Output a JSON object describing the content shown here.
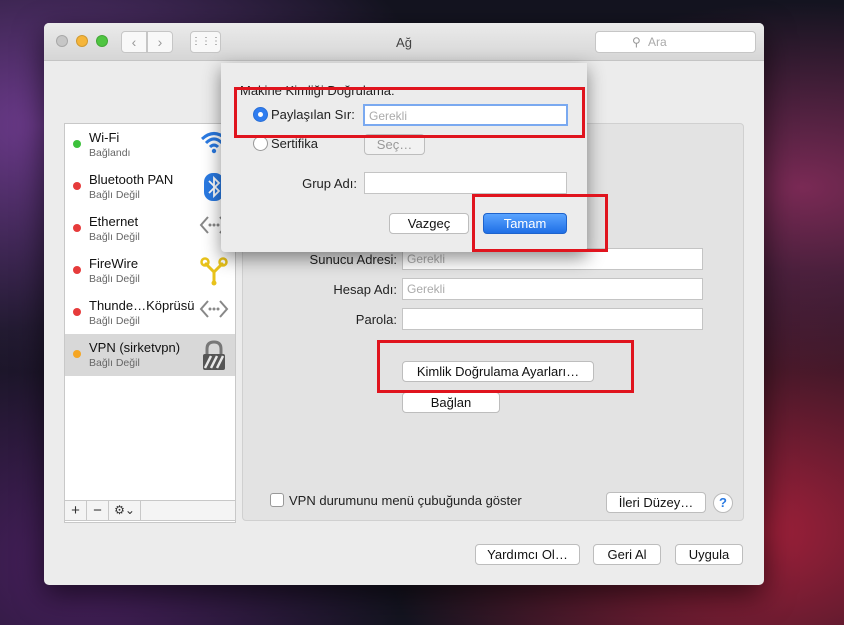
{
  "window": {
    "title": "Ağ",
    "search_placeholder": "Ara",
    "nav_back": "‹",
    "nav_forward": "›",
    "grid": "⋮⋮⋮"
  },
  "sidebar": {
    "items": [
      {
        "name": "Wi-Fi",
        "status": "Bağlandı",
        "dot": "#3cc13b",
        "icon": "wifi-icon"
      },
      {
        "name": "Bluetooth PAN",
        "status": "Bağlı Değil",
        "dot": "#e63b3b",
        "icon": "bluetooth-icon"
      },
      {
        "name": "Ethernet",
        "status": "Bağlı Değil",
        "dot": "#e63b3b",
        "icon": "ethernet-icon"
      },
      {
        "name": "FireWire",
        "status": "Bağlı Değil",
        "dot": "#e63b3b",
        "icon": "firewire-icon"
      },
      {
        "name": "Thunde…Köprüsü",
        "status": "Bağlı Değil",
        "dot": "#e63b3b",
        "icon": "thunderbolt-bridge-icon"
      },
      {
        "name": "VPN (sirketvpn)",
        "status": "Bağlı Değil",
        "dot": "#f5a623",
        "icon": "vpn-lock-icon"
      }
    ],
    "add": "+",
    "remove": "−",
    "actions": "⚙⌄"
  },
  "vpn_panel": {
    "server_address_label": "Sunucu Adresi:",
    "server_address_placeholder": "Gerekli",
    "account_name_label": "Hesap Adı:",
    "account_name_placeholder": "Gerekli",
    "password_label": "Parola:",
    "auth_settings_button": "Kimlik Doğrulama Ayarları…",
    "connect_button": "Bağlan",
    "show_vpn_status_label": "VPN durumunu menü çubuğunda göster",
    "advanced_button": "İleri Düzey…",
    "help": "?"
  },
  "footer": {
    "assist_button": "Yardımcı Ol…",
    "revert_button": "Geri Al",
    "apply_button": "Uygula"
  },
  "sheet": {
    "title": "Makine Kimliği Doğrulama:",
    "shared_secret_label": "Paylaşılan Sır:",
    "shared_secret_placeholder": "Gerekli",
    "certificate_label": "Sertifika",
    "select_button": "Seç…",
    "group_name_label": "Grup Adı:",
    "cancel_button": "Vazgeç",
    "ok_button": "Tamam"
  },
  "colors": {
    "highlight": "#e0141e",
    "accent": "#2f7df0"
  }
}
